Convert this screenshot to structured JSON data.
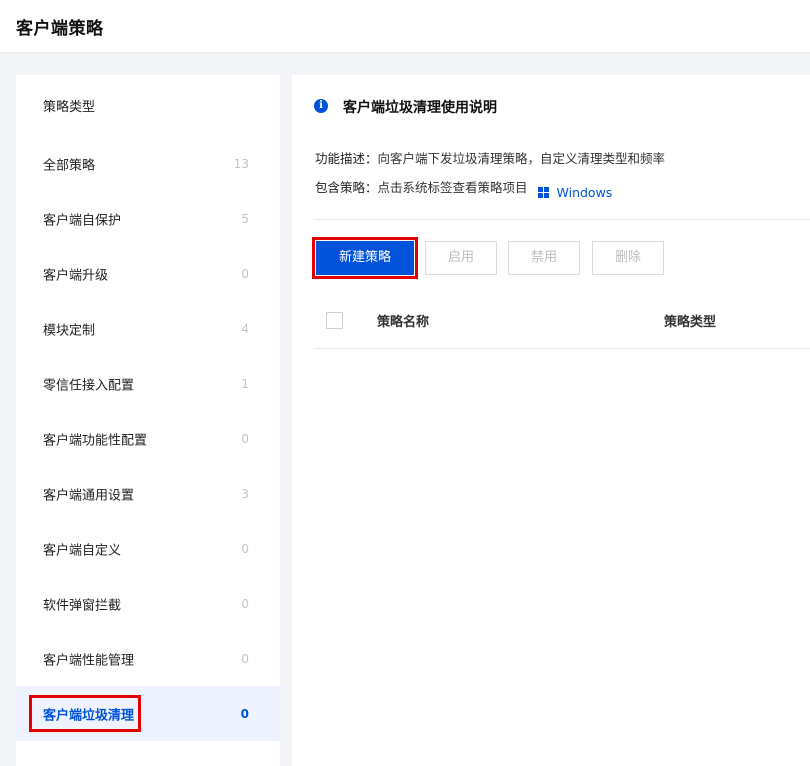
{
  "header": {
    "title": "客户端策略"
  },
  "sidebar": {
    "title": "策略类型",
    "items": [
      {
        "label": "全部策略",
        "count": "13"
      },
      {
        "label": "客户端自保护",
        "count": "5"
      },
      {
        "label": "客户端升级",
        "count": "0"
      },
      {
        "label": "模块定制",
        "count": "4"
      },
      {
        "label": "零信任接入配置",
        "count": "1"
      },
      {
        "label": "客户端功能性配置",
        "count": "0"
      },
      {
        "label": "客户端通用设置",
        "count": "3"
      },
      {
        "label": "客户端自定义",
        "count": "0"
      },
      {
        "label": "软件弹窗拦截",
        "count": "0"
      },
      {
        "label": "客户端性能管理",
        "count": "0"
      },
      {
        "label": "客户端垃圾清理",
        "count": "0"
      }
    ]
  },
  "main": {
    "info_title": "客户端垃圾清理使用说明",
    "desc_key": "功能描述：",
    "desc_value": "向客户端下发垃圾清理策略，自定义清理类型和频率",
    "include_key": "包含策略：",
    "include_value": "点击系统标签查看策略项目",
    "windows_label": "Windows",
    "buttons": {
      "new": "新建策略",
      "enable": "启用",
      "disable": "禁用",
      "delete": "删除"
    },
    "table": {
      "columns": [
        "策略名称",
        "策略类型"
      ]
    }
  },
  "colors": {
    "accent": "#0052d9",
    "highlight": "#e30000"
  }
}
